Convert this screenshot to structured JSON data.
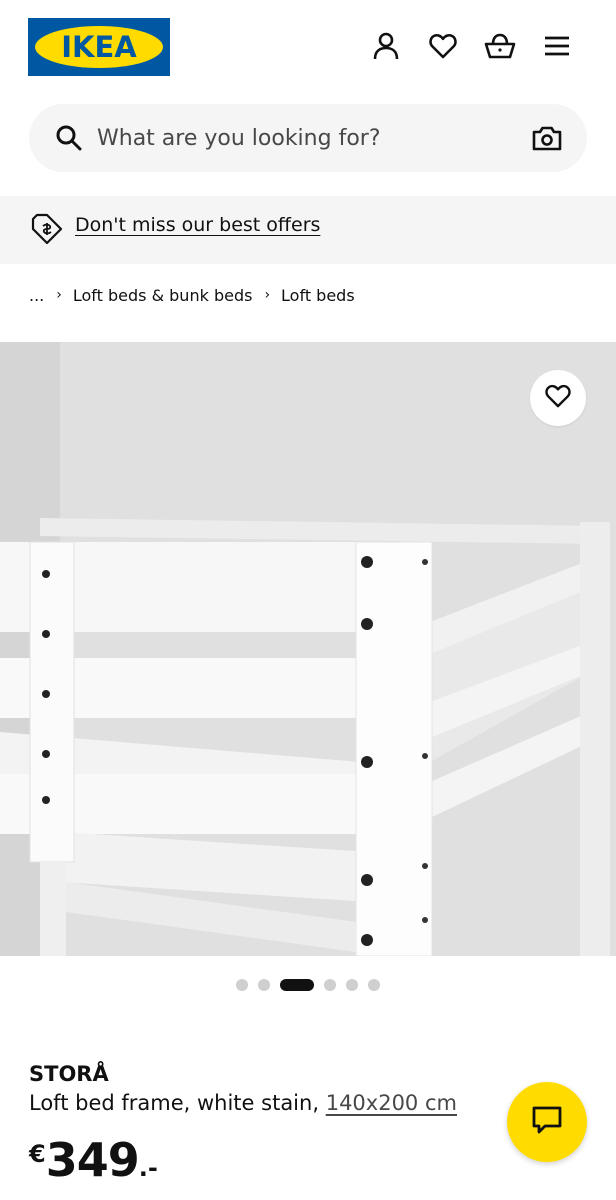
{
  "header": {
    "logo_text": "IKEA",
    "icons": [
      "profile-icon",
      "heart-icon",
      "basket-icon",
      "hamburger-menu-icon"
    ]
  },
  "search": {
    "placeholder": "What are you looking for?",
    "icon": "search-icon",
    "visual_search_icon": "camera-icon"
  },
  "offers": {
    "label": "Don't miss our best offers",
    "icon": "price-tag-icon"
  },
  "breadcrumb": {
    "items": [
      "...",
      "Loft beds & bunk beds",
      "Loft beds"
    ]
  },
  "gallery": {
    "favorite_icon": "heart-icon",
    "dot_count": 6,
    "active_dot": 2
  },
  "product": {
    "name": "STORÅ",
    "description": "Loft bed frame, white stain,",
    "size": "140x200 cm",
    "price": {
      "currency": "€",
      "integer": "349",
      "decimal": ".-"
    }
  },
  "chat": {
    "icon": "chat-icon"
  },
  "colors": {
    "ikea_blue": "#0058a3",
    "ikea_yellow": "#ffdb00",
    "text": "#111111",
    "surface": "#f5f5f5"
  }
}
